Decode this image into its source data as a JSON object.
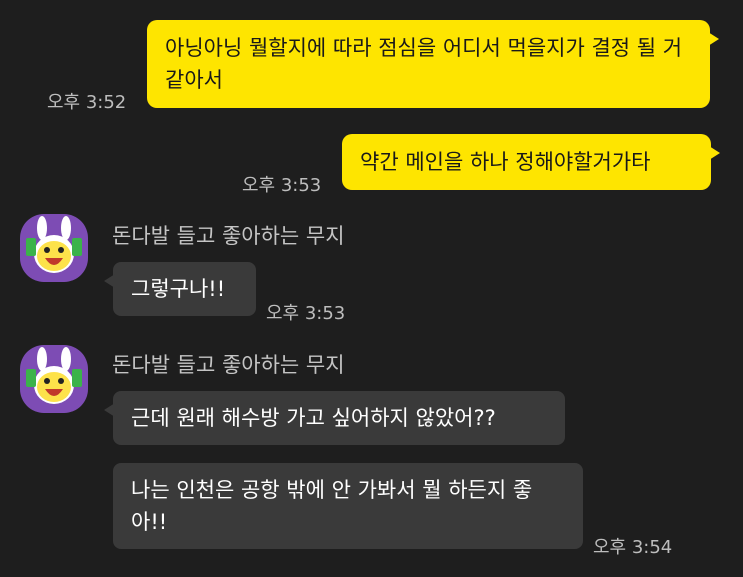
{
  "messages": [
    {
      "direction": "out",
      "text": "아닝아닝 뭘할지에 따라 점심을 어디서 먹을지가 결정 될 거 같아서",
      "time": "오후 3:52"
    },
    {
      "direction": "out",
      "text": "약간 메인을 하나 정해야할거가타",
      "time": "오후 3:53"
    },
    {
      "direction": "in",
      "sender": "돈다발 들고 좋아하는 무지",
      "text": "그렇구나!!",
      "time": "오후 3:53"
    },
    {
      "direction": "in",
      "sender": "돈다발 들고 좋아하는 무지",
      "text": "근데 원래 해수방 가고 싶어하지 않았어??"
    },
    {
      "direction": "in",
      "text": "나는 인천은 공항 밖에 안 가봐서 뭘 하든지 좋아!!",
      "time": "오후 3:54"
    }
  ],
  "avatar_icon": "muzi-holding-money-icon",
  "colors": {
    "background": "#1e1e1e",
    "outgoing": "#fee500",
    "incoming": "#3a3a3a",
    "avatar_bg": "#7d4cb4"
  }
}
